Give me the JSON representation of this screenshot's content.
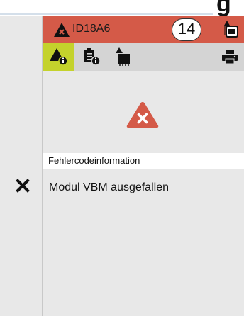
{
  "header": {
    "partial_title_glyph": "g"
  },
  "alert_bar": {
    "id": "ID18A6",
    "count": "14",
    "color": "#d45a48"
  },
  "toolbar": {
    "active_color": "#c4d22c",
    "items": [
      {
        "icon": "warning-info-icon",
        "active": true
      },
      {
        "icon": "clipboard-info-icon",
        "active": false
      },
      {
        "icon": "module-warning-icon",
        "active": false
      },
      {
        "icon": "printer-icon",
        "active": false
      }
    ]
  },
  "content": {
    "warning_icon": "warning-x-icon",
    "section_label": "Fehlercodeinformation",
    "message": "Modul VBM ausgefallen"
  },
  "left_rail": {
    "close_icon": "close-icon"
  }
}
